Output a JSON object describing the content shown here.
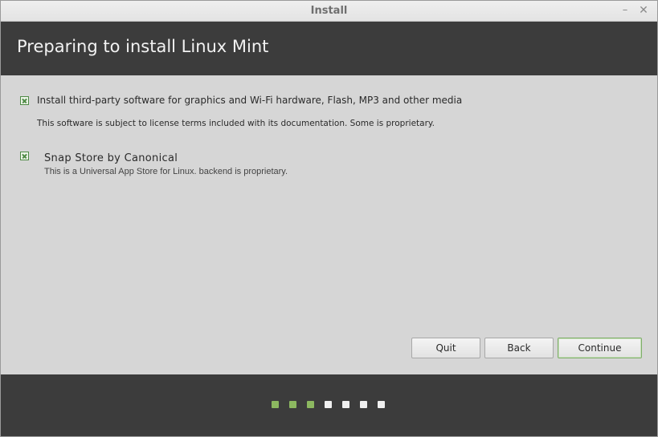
{
  "window": {
    "title": "Install",
    "minimize_glyph": "–",
    "close_glyph": "✕"
  },
  "header": {
    "title": "Preparing to install Linux Mint"
  },
  "options": [
    {
      "label": "Install third-party software for graphics and Wi-Fi hardware, Flash, MP3 and other media",
      "note": "This software is subject to license terms included with its documentation. Some is proprietary.",
      "checked": true
    },
    {
      "label": "Snap Store by Canonical",
      "note": "This is a Universal App Store for Linux. backend is proprietary.",
      "checked": true
    }
  ],
  "buttons": {
    "quit": "Quit",
    "back": "Back",
    "continue": "Continue"
  },
  "progress": {
    "total_steps": 7,
    "completed_steps": 3
  },
  "colors": {
    "header_bg": "#3c3c3c",
    "accent_green": "#8cb860",
    "check_green": "#4e8a45"
  }
}
